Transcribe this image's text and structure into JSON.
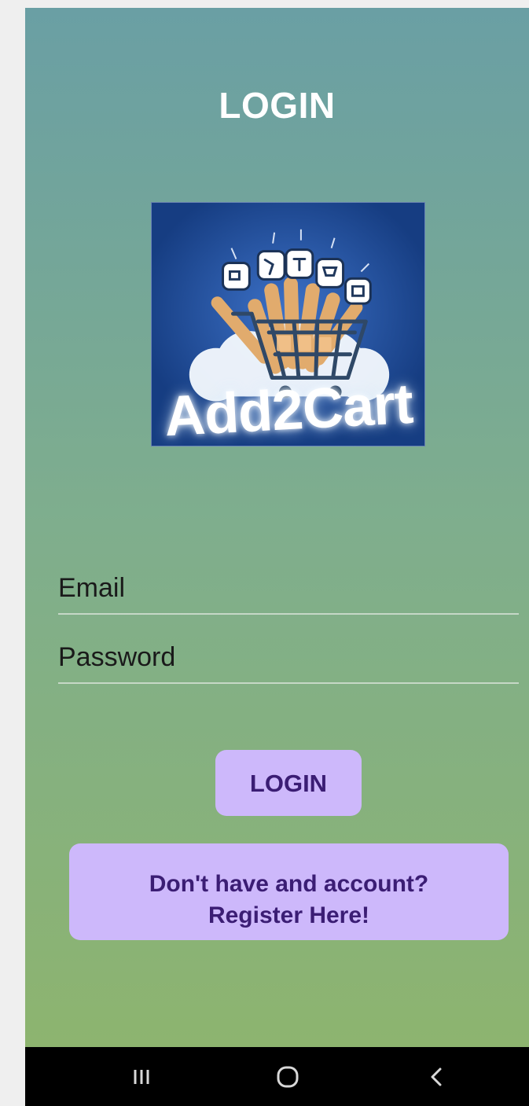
{
  "screen": {
    "title": "LOGIN"
  },
  "logo": {
    "wordmark": "Add2Cart"
  },
  "form": {
    "email": {
      "placeholder": "Email",
      "value": ""
    },
    "password": {
      "placeholder": "Password",
      "value": ""
    },
    "login_label": "LOGIN",
    "register_line1": "Don't have and account?",
    "register_line2": "Register Here!"
  },
  "nav": {
    "recents_icon": "recents-icon",
    "home_icon": "home-icon",
    "back_icon": "back-icon"
  },
  "colors": {
    "button_fill": "#cdb8fb",
    "button_text": "#3b1d74",
    "gradient_top": "#6a9fa4",
    "gradient_bottom": "#8db46f"
  }
}
